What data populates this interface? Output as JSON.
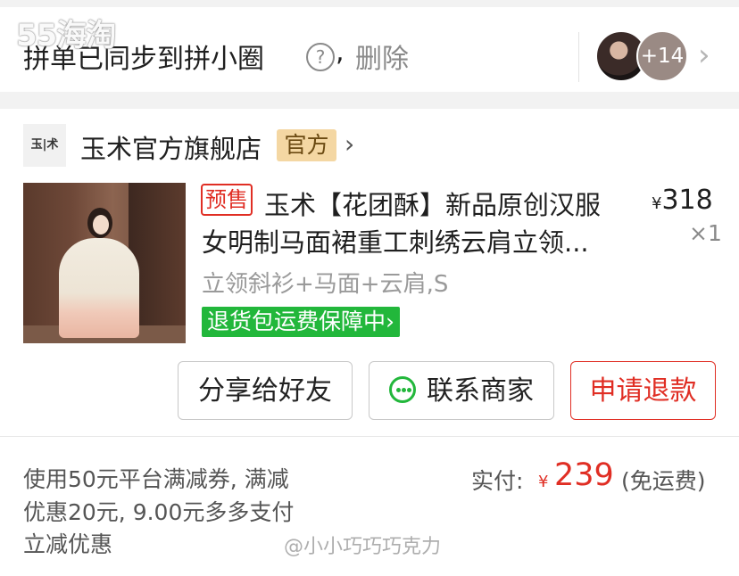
{
  "watermark_top": "55海淘",
  "sync_bar": {
    "text": "拼单已同步到拼小圈",
    "help_icon": "?",
    "separator": ",",
    "delete_label": "删除",
    "member_more": "+14",
    "chevron": "›"
  },
  "shop": {
    "logo_text": "玉|术",
    "name": "玉术官方旗舰店",
    "badge": "官方",
    "chevron": "›"
  },
  "product": {
    "presale_badge": "预售",
    "title_line1": "玉术【花团酥】新品原创汉服",
    "title_line2": "女明制马面裙重工刺绣云肩立领...",
    "currency": "¥",
    "price": "318",
    "quantity": "×1",
    "spec": "立领斜衫+马面+云肩,S",
    "guarantee": "退货包运费保障中",
    "guarantee_arrow": "›"
  },
  "actions": {
    "share": "分享给好友",
    "contact": "联系商家",
    "refund": "申请退款"
  },
  "summary": {
    "discount_line1": "使用50元平台满减券, 满减",
    "discount_line2": "优惠20元, 9.00元多多支付",
    "discount_line3": "立减优惠",
    "paid_label": "实付:",
    "currency": "¥",
    "paid_amount": "239",
    "shipping_note": "(免运费)"
  },
  "watermark_bottom": "@小小巧巧巧克力",
  "colors": {
    "accent_red": "#e02e24",
    "guarantee_green": "#22b73b",
    "badge_gold": "#f4d7a3"
  }
}
